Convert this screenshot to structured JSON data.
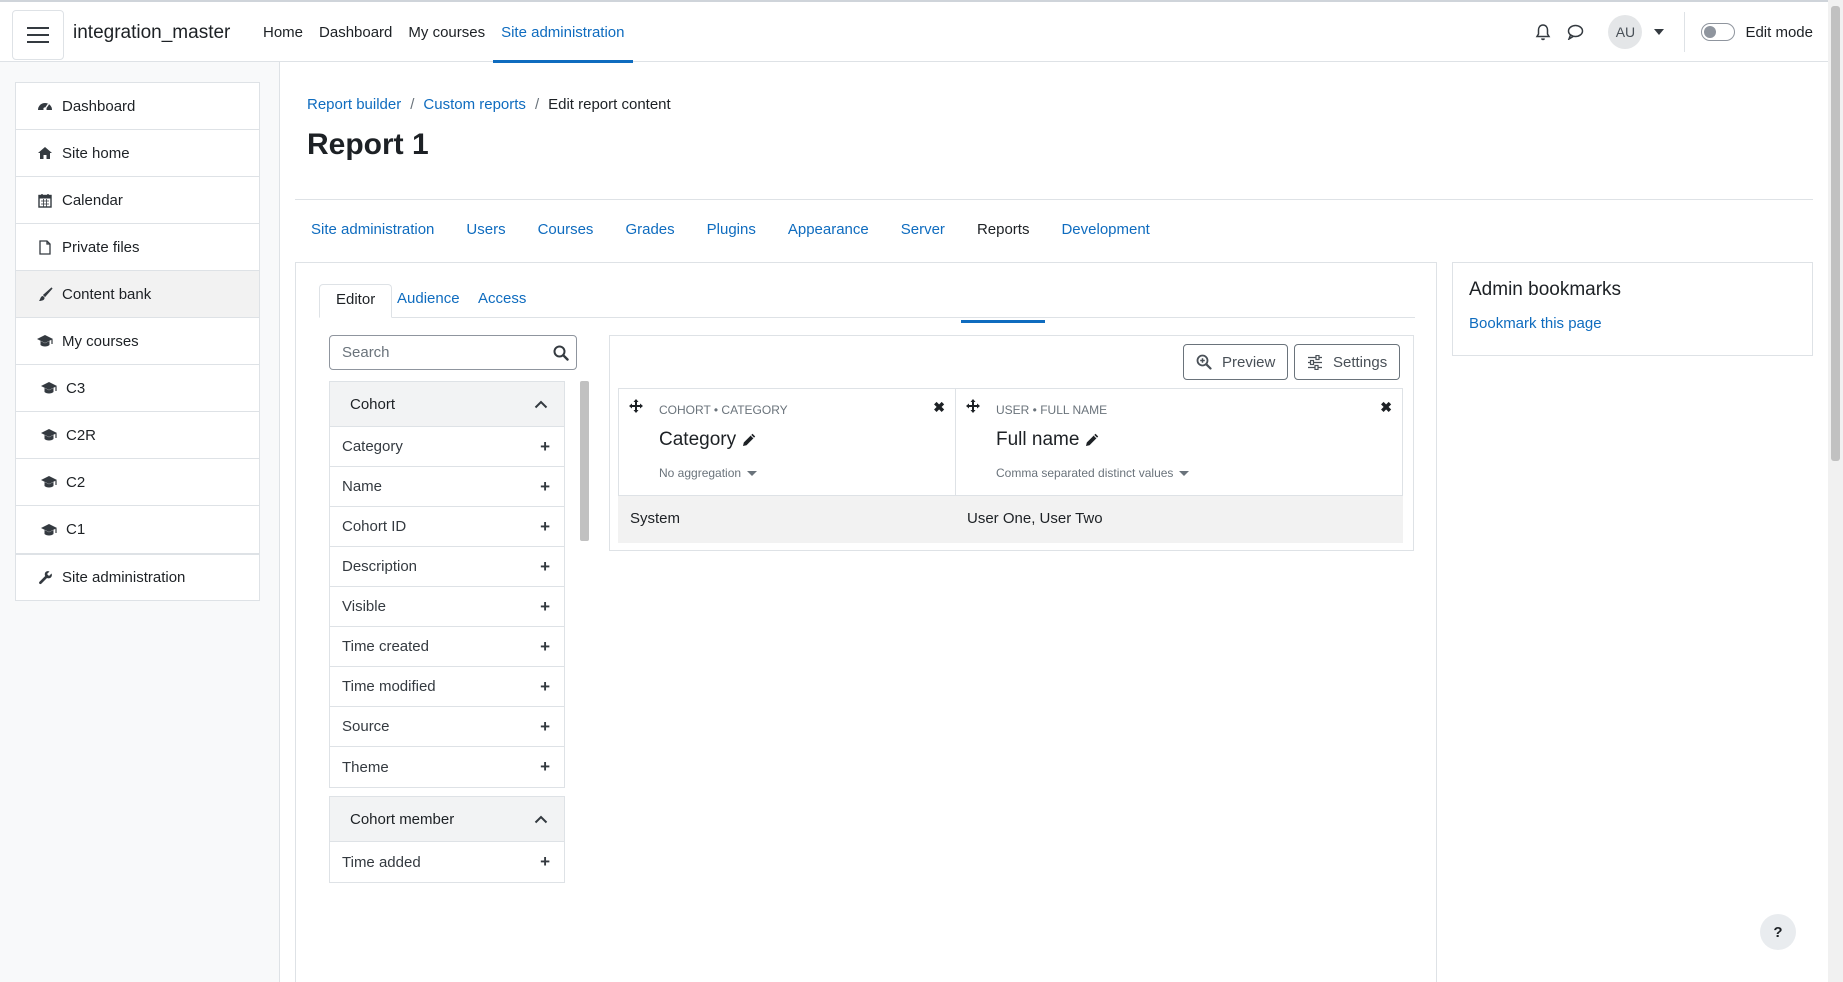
{
  "navbar": {
    "site_name": "integration_master",
    "primary_nav": [
      "Home",
      "Dashboard",
      "My courses",
      "Site administration"
    ],
    "active_item": "Site administration",
    "user_initials": "AU",
    "edit_mode_label": "Edit mode",
    "edit_mode_on": false
  },
  "drawer": {
    "items": [
      {
        "label": "Dashboard",
        "icon": "dashboard-icon"
      },
      {
        "label": "Site home",
        "icon": "home-icon"
      },
      {
        "label": "Calendar",
        "icon": "calendar-icon"
      },
      {
        "label": "Private files",
        "icon": "file-icon"
      },
      {
        "label": "Content bank",
        "icon": "paintbrush-icon"
      },
      {
        "label": "My courses",
        "icon": "graduation-cap-icon"
      },
      {
        "label": "C3",
        "icon": "graduation-cap-icon"
      },
      {
        "label": "C2R",
        "icon": "graduation-cap-icon"
      },
      {
        "label": "C2",
        "icon": "graduation-cap-icon"
      },
      {
        "label": "C1",
        "icon": "graduation-cap-icon"
      }
    ],
    "site_admin_label": "Site administration"
  },
  "breadcrumb": [
    "Report builder",
    "Custom reports",
    "Edit report content"
  ],
  "page_title": "Report 1",
  "secondary_nav": [
    "Site administration",
    "Users",
    "Courses",
    "Grades",
    "Plugins",
    "Appearance",
    "Server",
    "Reports",
    "Development"
  ],
  "secondary_active": "Reports",
  "editor": {
    "tabs": [
      "Editor",
      "Audience",
      "Access"
    ],
    "active_tab": "Editor",
    "search_placeholder": "Search",
    "sections": [
      {
        "title": "Cohort",
        "fields": [
          "Category",
          "Name",
          "Cohort ID",
          "Description",
          "Visible",
          "Time created",
          "Time modified",
          "Source",
          "Theme"
        ]
      },
      {
        "title": "Cohort member",
        "fields": [
          "Time added"
        ]
      }
    ]
  },
  "report": {
    "preview_label": "Preview",
    "settings_label": "Settings",
    "columns": [
      {
        "kicker": "COHORT • CATEGORY",
        "title": "Category",
        "aggregation": "No aggregation"
      },
      {
        "kicker": "USER • FULL NAME",
        "title": "Full name",
        "aggregation": "Comma separated distinct values"
      }
    ],
    "rows": [
      [
        "System",
        "User One, User Two"
      ]
    ]
  },
  "bookmarks": {
    "title": "Admin bookmarks",
    "link": "Bookmark this page"
  },
  "help_label": "?"
}
